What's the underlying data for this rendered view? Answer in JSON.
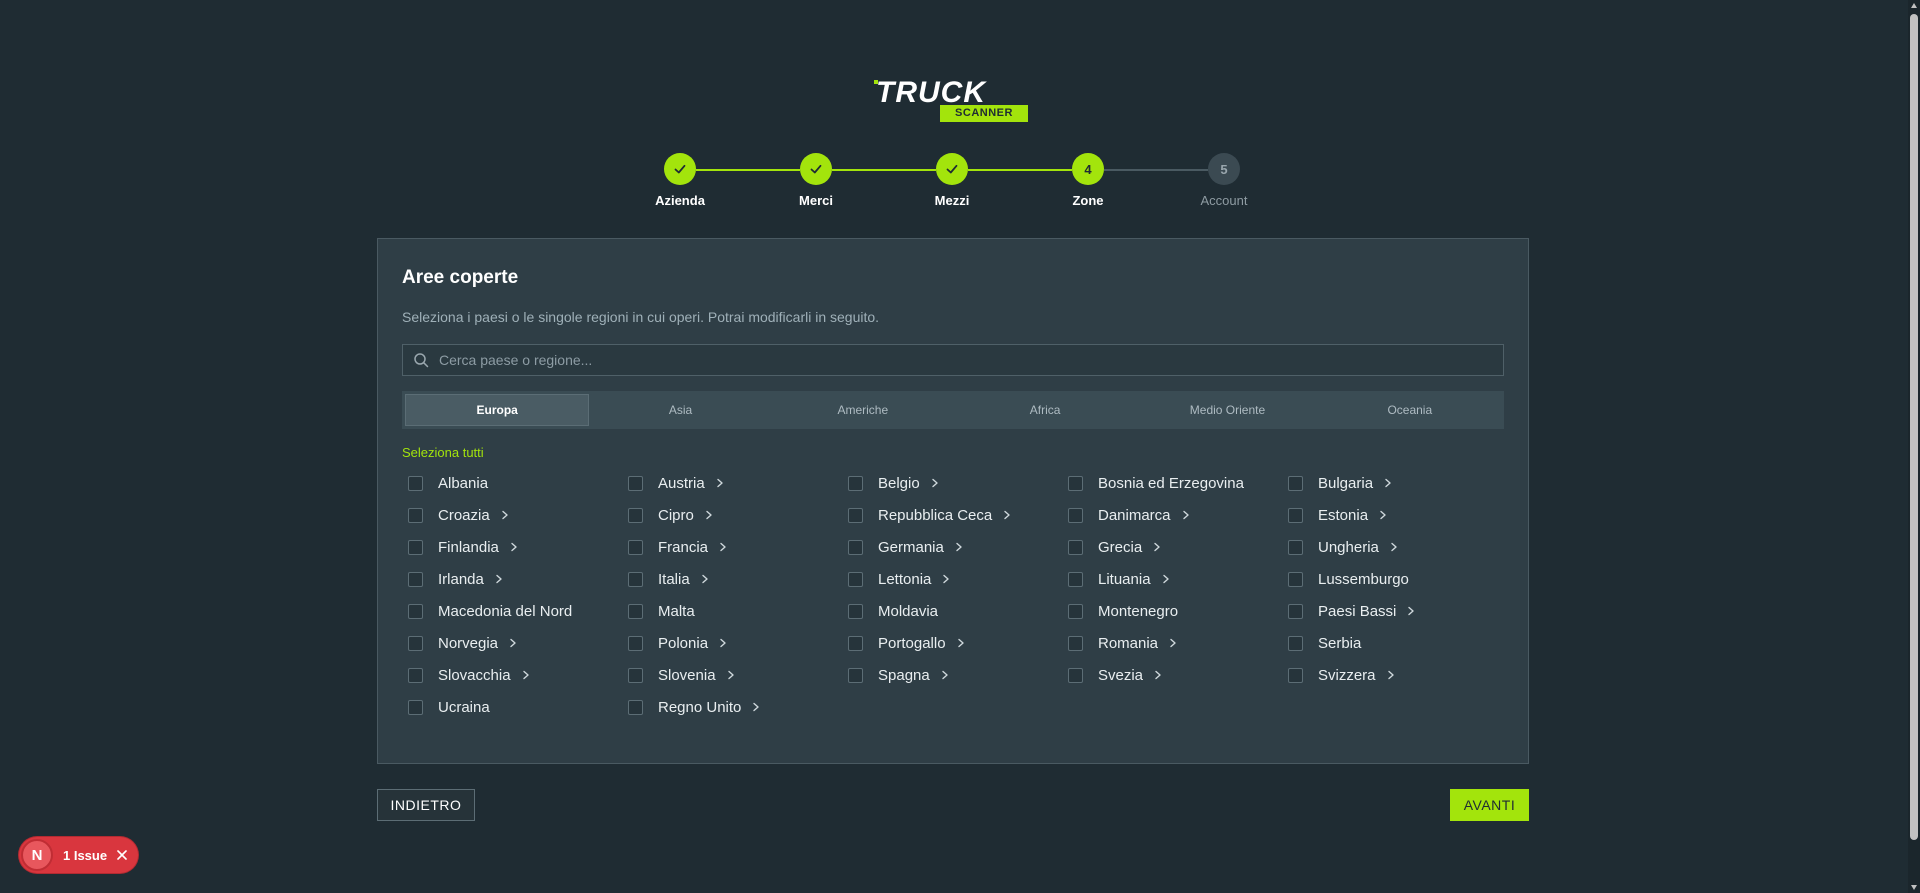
{
  "logo": {
    "word": "TRUCK",
    "badge": "SCANNER"
  },
  "stepper": {
    "steps": [
      {
        "label": "Azienda",
        "state": "done",
        "number": ""
      },
      {
        "label": "Merci",
        "state": "done",
        "number": ""
      },
      {
        "label": "Mezzi",
        "state": "done",
        "number": ""
      },
      {
        "label": "Zone",
        "state": "active",
        "number": "4"
      },
      {
        "label": "Account",
        "state": "pending",
        "number": "5"
      }
    ]
  },
  "card": {
    "title": "Aree coperte",
    "description": "Seleziona i paesi o le singole regioni in cui operi. Potrai modificarli in seguito.",
    "search_placeholder": "Cerca paese o regione...",
    "tabs": [
      "Europa",
      "Asia",
      "Americhe",
      "Africa",
      "Medio Oriente",
      "Oceania"
    ],
    "active_tab": "Europa",
    "select_all": "Seleziona tutti",
    "countries": [
      {
        "name": "Albania",
        "has_regions": false
      },
      {
        "name": "Austria",
        "has_regions": true
      },
      {
        "name": "Belgio",
        "has_regions": true
      },
      {
        "name": "Bosnia ed Erzegovina",
        "has_regions": false
      },
      {
        "name": "Bulgaria",
        "has_regions": true
      },
      {
        "name": "Croazia",
        "has_regions": true
      },
      {
        "name": "Cipro",
        "has_regions": true
      },
      {
        "name": "Repubblica Ceca",
        "has_regions": true
      },
      {
        "name": "Danimarca",
        "has_regions": true
      },
      {
        "name": "Estonia",
        "has_regions": true
      },
      {
        "name": "Finlandia",
        "has_regions": true
      },
      {
        "name": "Francia",
        "has_regions": true
      },
      {
        "name": "Germania",
        "has_regions": true
      },
      {
        "name": "Grecia",
        "has_regions": true
      },
      {
        "name": "Ungheria",
        "has_regions": true
      },
      {
        "name": "Irlanda",
        "has_regions": true
      },
      {
        "name": "Italia",
        "has_regions": true
      },
      {
        "name": "Lettonia",
        "has_regions": true
      },
      {
        "name": "Lituania",
        "has_regions": true
      },
      {
        "name": "Lussemburgo",
        "has_regions": false
      },
      {
        "name": "Macedonia del Nord",
        "has_regions": false
      },
      {
        "name": "Malta",
        "has_regions": false
      },
      {
        "name": "Moldavia",
        "has_regions": false
      },
      {
        "name": "Montenegro",
        "has_regions": false
      },
      {
        "name": "Paesi Bassi",
        "has_regions": true
      },
      {
        "name": "Norvegia",
        "has_regions": true
      },
      {
        "name": "Polonia",
        "has_regions": true
      },
      {
        "name": "Portogallo",
        "has_regions": true
      },
      {
        "name": "Romania",
        "has_regions": true
      },
      {
        "name": "Serbia",
        "has_regions": false
      },
      {
        "name": "Slovacchia",
        "has_regions": true
      },
      {
        "name": "Slovenia",
        "has_regions": true
      },
      {
        "name": "Spagna",
        "has_regions": true
      },
      {
        "name": "Svezia",
        "has_regions": true
      },
      {
        "name": "Svizzera",
        "has_regions": true
      },
      {
        "name": "Ucraina",
        "has_regions": false
      },
      {
        "name": "Regno Unito",
        "has_regions": true
      }
    ]
  },
  "footer": {
    "back_label": "INDIETRO",
    "next_label": "AVANTI"
  },
  "issue": {
    "avatar": "N",
    "label": "1 Issue"
  },
  "colors": {
    "background": "#1f2c33",
    "accent": "#a3e40c",
    "card": "#2f3e46",
    "danger": "#d9363e"
  }
}
